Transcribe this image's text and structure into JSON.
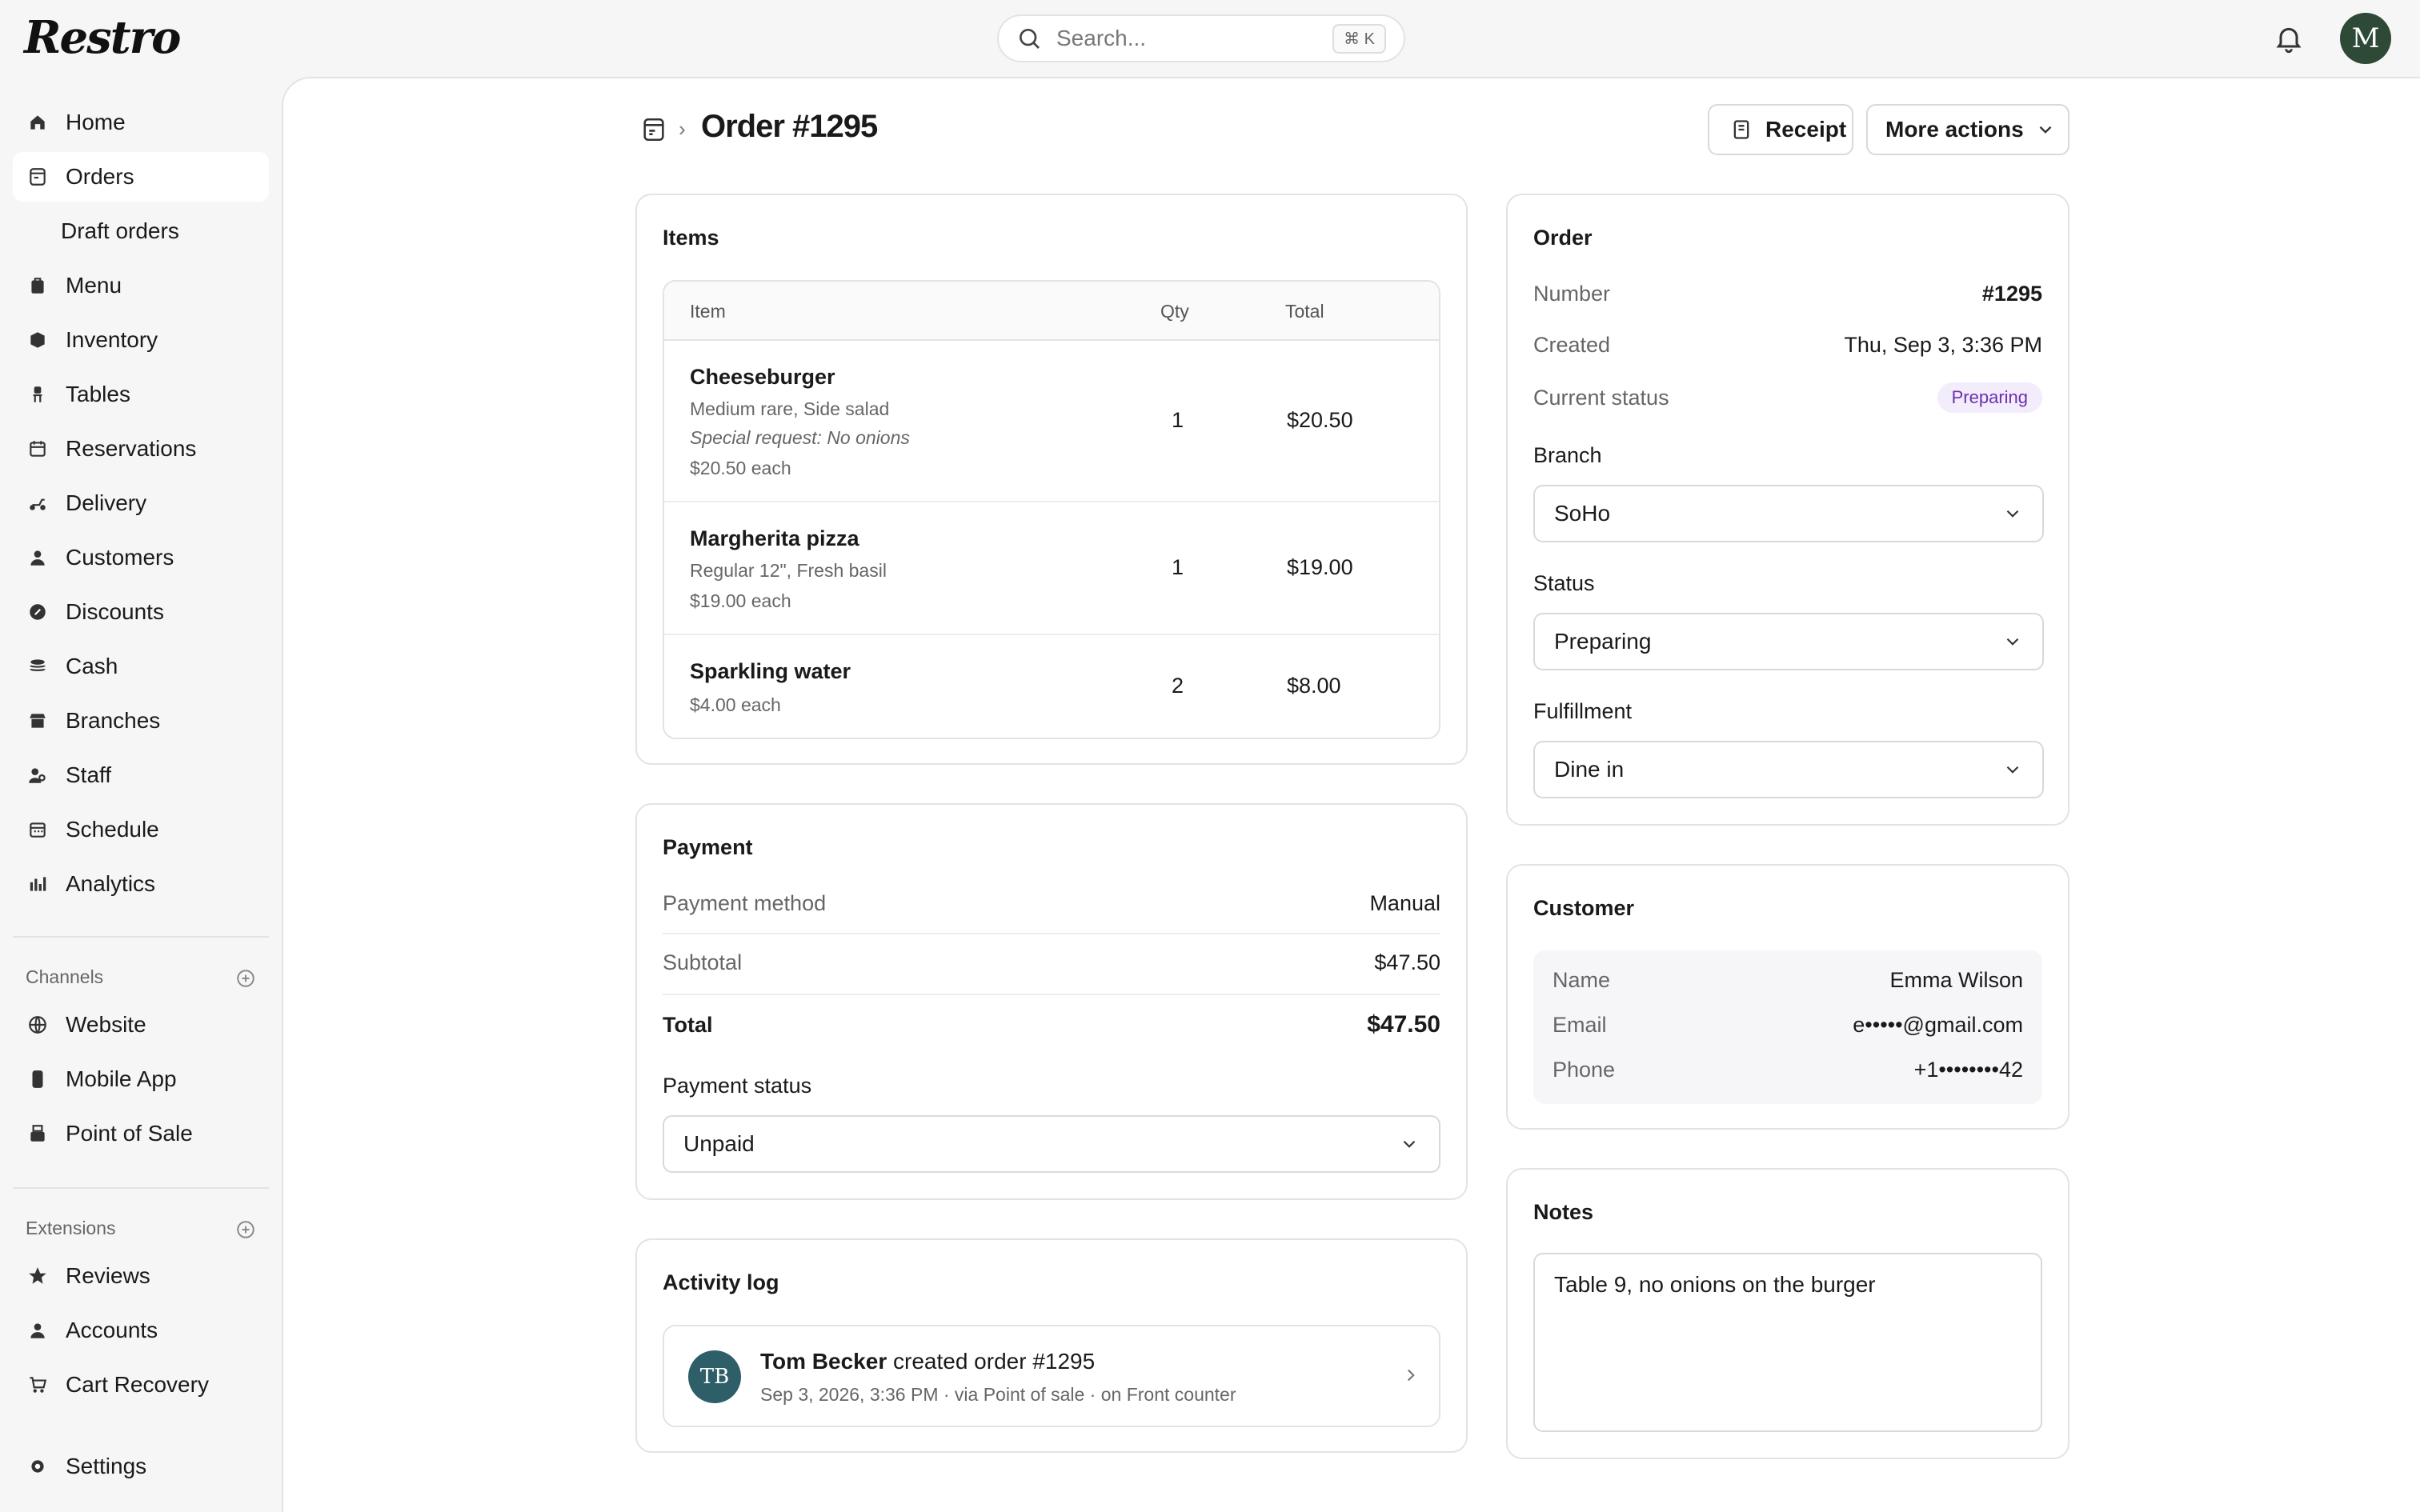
{
  "app": {
    "logo": "Restro"
  },
  "search": {
    "placeholder": "Search...",
    "shortcut": "⌘ K"
  },
  "user": {
    "avatar_initial": "M"
  },
  "sidebar": {
    "items": [
      {
        "label": "Home",
        "icon": "home-icon"
      },
      {
        "label": "Orders",
        "icon": "orders-icon",
        "active": true
      },
      {
        "label": "Draft orders",
        "icon": ""
      },
      {
        "label": "Menu",
        "icon": "menu-icon"
      },
      {
        "label": "Inventory",
        "icon": "inventory-icon"
      },
      {
        "label": "Tables",
        "icon": "tables-icon"
      },
      {
        "label": "Reservations",
        "icon": "calendar-icon"
      },
      {
        "label": "Delivery",
        "icon": "scooter-icon"
      },
      {
        "label": "Customers",
        "icon": "person-icon"
      },
      {
        "label": "Discounts",
        "icon": "discount-icon"
      },
      {
        "label": "Cash",
        "icon": "cash-icon"
      },
      {
        "label": "Branches",
        "icon": "store-icon"
      },
      {
        "label": "Staff",
        "icon": "staff-icon"
      },
      {
        "label": "Schedule",
        "icon": "schedule-icon"
      },
      {
        "label": "Analytics",
        "icon": "analytics-icon"
      }
    ],
    "channels_title": "Channels",
    "channels": [
      {
        "label": "Website",
        "icon": "globe-icon"
      },
      {
        "label": "Mobile App",
        "icon": "phone-icon"
      },
      {
        "label": "Point of Sale",
        "icon": "pos-icon"
      }
    ],
    "extensions_title": "Extensions",
    "extensions": [
      {
        "label": "Reviews",
        "icon": "star-icon"
      },
      {
        "label": "Accounts",
        "icon": "person-icon"
      },
      {
        "label": "Cart Recovery",
        "icon": "cart-icon"
      }
    ],
    "settings": {
      "label": "Settings",
      "icon": "gear-icon"
    }
  },
  "header": {
    "title": "Order #1295",
    "receipt_label": "Receipt",
    "more_actions_label": "More actions"
  },
  "items_card": {
    "title": "Items",
    "columns": {
      "item": "Item",
      "qty": "Qty",
      "total": "Total"
    },
    "rows": [
      {
        "name": "Cheeseburger",
        "lines": [
          "Medium rare, Side salad",
          "Special request: No onions",
          "$20.50 each"
        ],
        "qty": "1",
        "total": "$20.50"
      },
      {
        "name": "Margherita pizza",
        "lines": [
          "Regular 12\", Fresh basil",
          "$19.00 each"
        ],
        "qty": "1",
        "total": "$19.00"
      },
      {
        "name": "Sparkling water",
        "lines": [
          "$4.00 each"
        ],
        "qty": "2",
        "total": "$8.00"
      }
    ]
  },
  "payment_card": {
    "title": "Payment",
    "method_label": "Payment method",
    "method_value": "Manual",
    "subtotal_label": "Subtotal",
    "subtotal_value": "$47.50",
    "total_label": "Total",
    "total_value": "$47.50",
    "status_label": "Payment status",
    "status_value": "Unpaid"
  },
  "activity_card": {
    "title": "Activity log",
    "entry": {
      "initials": "TB",
      "actor": "Tom Becker",
      "action": "created order #1295",
      "meta": "Sep 3, 2026, 3:36 PM · via Point of sale · on Front counter"
    }
  },
  "order_card": {
    "title": "Order",
    "number_label": "Number",
    "number_value": "#1295",
    "created_label": "Created",
    "created_value": "Thu, Sep 3, 3:36 PM",
    "current_status_label": "Current status",
    "current_status_value": "Preparing",
    "branch_label": "Branch",
    "branch_value": "SoHo",
    "status_label": "Status",
    "status_value": "Preparing",
    "fulfillment_label": "Fulfillment",
    "fulfillment_value": "Dine in"
  },
  "customer_card": {
    "title": "Customer",
    "name_label": "Name",
    "name_value": "Emma Wilson",
    "email_label": "Email",
    "email_value": "e•••••@gmail.com",
    "phone_label": "Phone",
    "phone_value": "+1••••••••42"
  },
  "notes_card": {
    "title": "Notes",
    "value": "Table 9, no onions on the burger"
  },
  "colors": {
    "accent_badge_bg": "#f3ecfb",
    "accent_badge_text": "#6b2fb0",
    "avatar_bg": "#2e4a36",
    "activity_avatar_bg": "#2e5f68"
  }
}
